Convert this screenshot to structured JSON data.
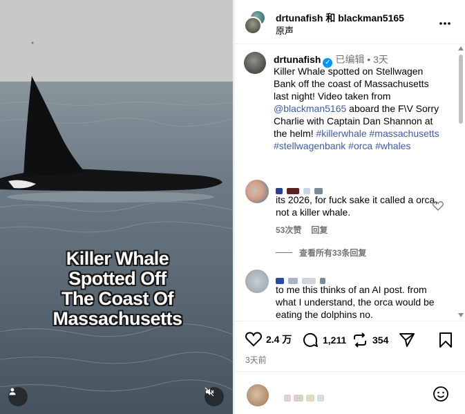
{
  "video": {
    "overlay_lines": [
      "Killer Whale",
      "Spotted Off",
      "The Coast Of",
      "Massachusetts"
    ],
    "user_icon": "user-icon",
    "mute_icon": "muted-speaker-icon"
  },
  "header": {
    "names": "drtunafish 和 blackman5165",
    "audio": "原声",
    "more_icon": "more-horizontal-icon"
  },
  "caption": {
    "username": "drtunafish",
    "edited": "已编辑",
    "dot": "•",
    "time": "3天",
    "text_1": "Killer Whale spotted on Stellwagen Bank off the coast of Massachusetts last night! Video taken from ",
    "mention": "@blackman5165",
    "text_2": " aboard the F\\V Sorry Charlie with Captain Dan Shannon at the helm! ",
    "hashtags": "#killerwhale #massachusetts #stellwagenbank #orca #whales"
  },
  "comments": [
    {
      "text": "its 2026, for fuck sake it called a orca, not a killer whale.",
      "likes": "53次赞",
      "reply": "回复"
    },
    {
      "text": "to me this thinks of an AI post. from what I understand, the orca would be eating the dolphins no."
    }
  ],
  "view_replies": "查看所有33条回复",
  "actions": {
    "likes": "2.4 万",
    "comments": "1,211",
    "reposts": "354"
  },
  "date": "3天前",
  "colors": {
    "link": "#3a5ca8",
    "verified": "#0095f6",
    "muted": "#737373"
  }
}
